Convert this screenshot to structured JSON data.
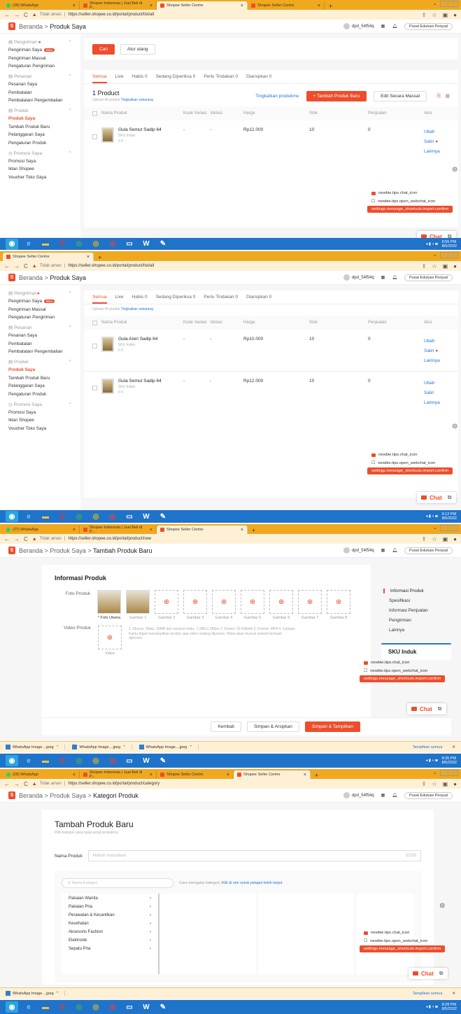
{
  "browser": {
    "ss1_tabs": [
      "(28) WhatsApp",
      "Shopee Indonesia | Jual Beli di P...",
      "Shopee Seller Centre",
      "Shopee Seller Centre"
    ],
    "ss2_tabs": [
      "Shopee Seller Centre"
    ],
    "ss3_tabs": [
      "(27) WhatsApp",
      "Shopee Indonesia | Jual Beli di P...",
      "Shopee Seller Centre"
    ],
    "ss4_tabs": [
      "(28) WhatsApp",
      "Shopee Indonesia | Jual Beli di P...",
      "Shopee Seller Centre",
      "Shopee Seller Centre"
    ],
    "not_secure": "Tidak aman",
    "url_list": "https://seller.shopee.co.id/portal/product/list/all",
    "url_new": "https://seller.shopee.co.id/portal/product/new",
    "url_category": "https://seller.shopee.co.id/portal/product/category"
  },
  "header": {
    "home": "Beranda",
    "sep": ">",
    "produk_saya": "Produk Saya",
    "tambah": "Tambah Produk Baru",
    "kategori": "Kategori Produk",
    "user": "dpd_54f54q",
    "edu": "Pusat Edukasi Penjual"
  },
  "sidebar": {
    "pengiriman": "Pengiriman",
    "pengiriman_saya": "Pengiriman Saya",
    "new_badge": "Baru",
    "pengiriman_massal": "Pengiriman Massal",
    "pengaturan_pengiriman": "Pengaturan Pengiriman",
    "pesanan": "Pesanan",
    "pesanan_saya": "Pesanan Saya",
    "pembatalan": "Pembatalan",
    "pengembalian": "Pembatalan/ Pengembalian",
    "produk": "Produk",
    "produk_saya": "Produk Saya",
    "tambah_produk": "Tambah Produk Baru",
    "pelanggaran": "Pelanggaran Saya",
    "pengaturan_produk": "Pengaturan Produk",
    "promosi": "Promosi Saya",
    "promosi_saya": "Promosi Saya",
    "iklan": "Iklan Shopee",
    "voucher": "Voucher Toko Saya"
  },
  "list": {
    "cari": "Cari",
    "atur_ulang": "Atur ulang",
    "tabs": [
      "Semua",
      "Live",
      "Habis 0",
      "Sedang Diperiksa 0",
      "Perlu Tindakan 0",
      "Diarsipkan 0"
    ],
    "count": "1 Product",
    "upload_note": "Upload 49 produk",
    "upgrade_link": "Tingkatkan sekarang",
    "tingkatkan": "Tingkatkan produkmu",
    "tambah_btn": "+ Tambah Produk Baru",
    "edit_massal": "Edit Secara Massal",
    "cols": [
      "Nama Produk",
      "Kode Variasi",
      "Variasi",
      "Harga",
      "Stok",
      "Penjualan",
      "Aksi"
    ],
    "products": [
      {
        "name": "Gula Aren Sadip 64",
        "sku": "SKU Induk:",
        "stats": "0   0",
        "price": "Rp10.000",
        "stock": "10",
        "sales": "0"
      },
      {
        "name": "Gula Semut Sadip 64",
        "sku": "SKU Induk:",
        "stats": "0   0",
        "price": "Rp12.000",
        "stock": "10",
        "sales": "0"
      }
    ],
    "dash": "-",
    "ubah": "Ubah",
    "salin": "Salin",
    "lainnya": "Lainnya"
  },
  "tips": {
    "chat_icon": "newbie.tips.chat_icon",
    "webchat_icon": "newbie.tips.open_webchat_icon",
    "confirm": "settings.message_shortcuts.import.confirm",
    "chat": "Chat"
  },
  "form": {
    "title": "Informasi Produk",
    "foto_produk": "Foto Produk",
    "foto_utama": "* Foto Utama",
    "gambars": [
      "Gambar 1",
      "Gambar 2",
      "Gambar 3",
      "Gambar 4",
      "Gambar 5",
      "Gambar 6",
      "Gambar 7",
      "Gambar 8"
    ],
    "video_produk": "Video Produk",
    "video": "Video",
    "video_notes": "1. Ukuran: Maks. 30MB dan resolusi maks. 1.280x1.280px 2. Durasi: 10-60detik 3. Format: MP4 4. Catatan: Kamu dapat menampilkan produk saat video sedang diproses. Video akan muncul setelah berhasil diproses.",
    "kembali": "Kembali",
    "simpan_arsip": "Simpan & Arsipkan",
    "simpan_tampil": "Simpan & Tampilkan",
    "rnav": [
      "Informasi Produk",
      "Spesifikasi",
      "Informasi Penjualan",
      "Pengiriman",
      "Lainnya"
    ],
    "sku_induk": "SKU Induk"
  },
  "category": {
    "title": "Tambah Produk Baru",
    "subtitle": "Pilih kategori yang tepat untuk produkmu.",
    "nama_produk": "Nama Produk",
    "placeholder": "Mohon masukkan",
    "counter": "0/255",
    "search_ph": "Nama Kategori",
    "hint": "Cara mengatur kategori,",
    "hint_link": "Klik di sini untuk pelajari lebih lanjut",
    "cats": [
      "Pakaian Wanita",
      "Pakaian Pria",
      "Perawatan & Kecantikan",
      "Kesehatan",
      "Aksesoris Fashion",
      "Elektronik",
      "Sepatu Pria"
    ]
  },
  "downloads": {
    "file": "WhatsApp Image....jpeg",
    "show_all": "Tampilkan semua"
  },
  "taskbar": {
    "t1": "8:55 PM",
    "d1": "8/5/2022",
    "t2": "9:12 PM",
    "d2": "8/5/2022",
    "t3": "8:35 PM",
    "d3": "8/5/2022",
    "t4": "8:28 PM",
    "d4": "8/5/2022"
  }
}
